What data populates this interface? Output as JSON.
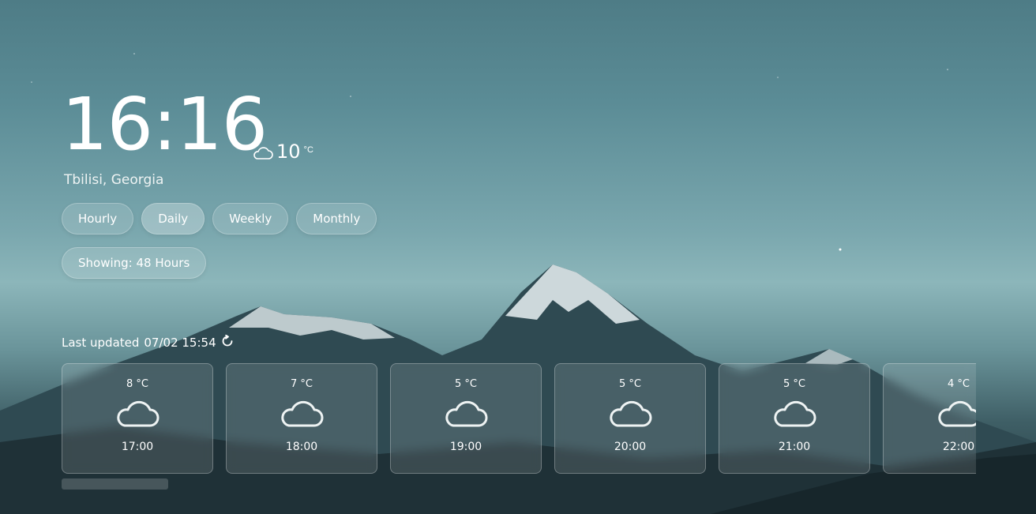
{
  "clock": {
    "time": "16:16"
  },
  "current": {
    "icon": "cloud-icon",
    "temp": "10",
    "unit": "°C"
  },
  "location": "Tbilisi, Georgia",
  "tabs": [
    {
      "label": "Hourly",
      "active": false
    },
    {
      "label": "Daily",
      "active": true
    },
    {
      "label": "Weekly",
      "active": false
    },
    {
      "label": "Monthly",
      "active": false
    }
  ],
  "showing": "Showing: 48 Hours",
  "updated": {
    "label": "Last updated",
    "value": "07/02 15:54",
    "icon": "refresh-icon"
  },
  "forecast": [
    {
      "temp": "8",
      "unit": "°C",
      "icon": "cloud-icon",
      "time": "17:00"
    },
    {
      "temp": "7",
      "unit": "°C",
      "icon": "cloud-icon",
      "time": "18:00"
    },
    {
      "temp": "5",
      "unit": "°C",
      "icon": "cloud-icon",
      "time": "19:00"
    },
    {
      "temp": "5",
      "unit": "°C",
      "icon": "cloud-icon",
      "time": "20:00"
    },
    {
      "temp": "5",
      "unit": "°C",
      "icon": "cloud-icon",
      "time": "21:00"
    },
    {
      "temp": "4",
      "unit": "°C",
      "icon": "cloud-icon",
      "time": "22:00"
    }
  ]
}
